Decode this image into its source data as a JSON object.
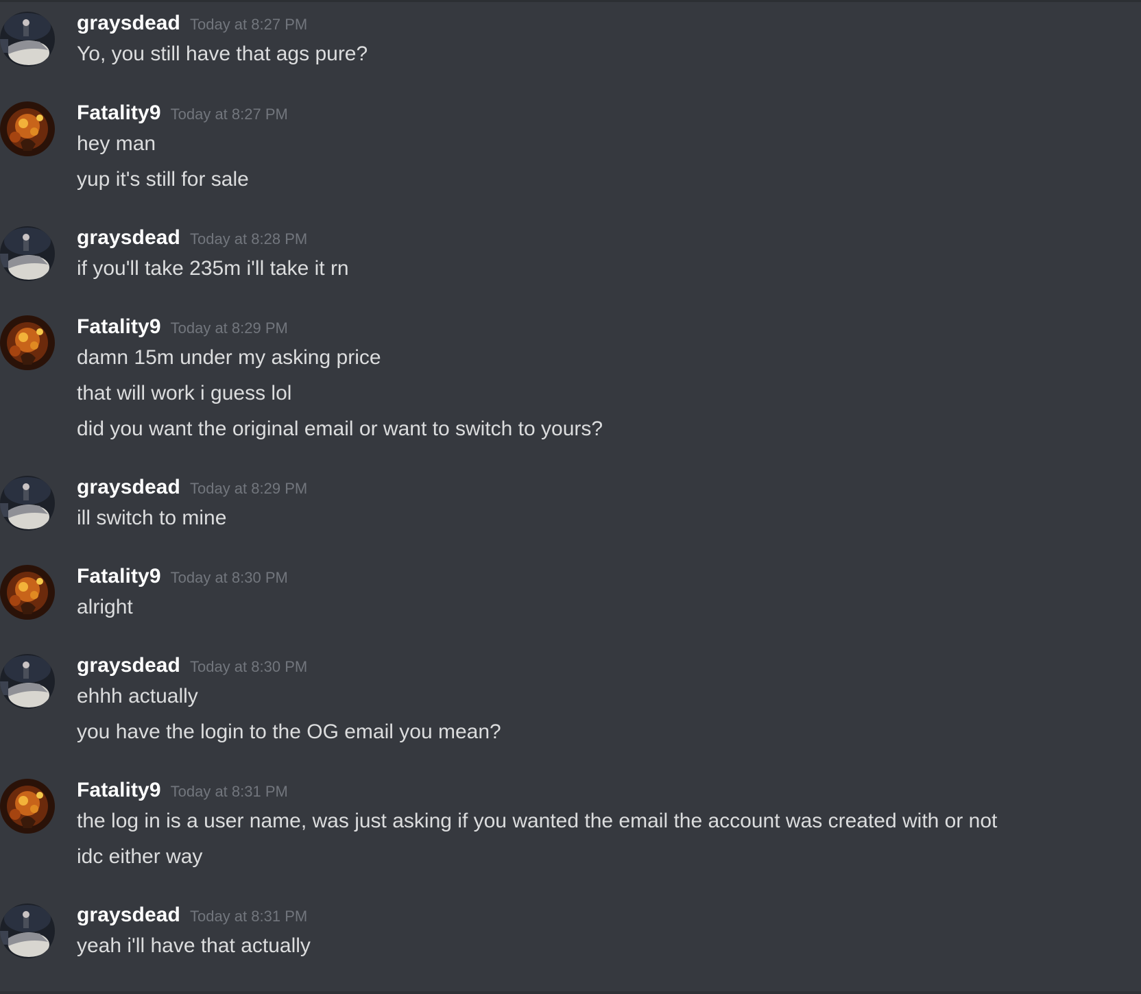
{
  "messages": [
    {
      "author": "graysdead",
      "avatar_icon": "graysdead-avatar-icon",
      "timestamp": "Today at 8:27 PM",
      "lines": [
        "Yo, you still have that ags pure?"
      ]
    },
    {
      "author": "Fatality9",
      "avatar_icon": "fatality9-avatar-icon",
      "timestamp": "Today at 8:27 PM",
      "lines": [
        "hey man",
        "yup it's still for sale"
      ]
    },
    {
      "author": "graysdead",
      "avatar_icon": "graysdead-avatar-icon",
      "timestamp": "Today at 8:28 PM",
      "lines": [
        "if you'll take 235m i'll take it rn"
      ]
    },
    {
      "author": "Fatality9",
      "avatar_icon": "fatality9-avatar-icon",
      "timestamp": "Today at 8:29 PM",
      "lines": [
        "damn 15m under my asking price",
        "that will work i guess lol",
        "did you want the original email or want to switch to yours?"
      ]
    },
    {
      "author": "graysdead",
      "avatar_icon": "graysdead-avatar-icon",
      "timestamp": "Today at 8:29 PM",
      "lines": [
        "ill switch to mine"
      ]
    },
    {
      "author": "Fatality9",
      "avatar_icon": "fatality9-avatar-icon",
      "timestamp": "Today at 8:30 PM",
      "lines": [
        "alright"
      ]
    },
    {
      "author": "graysdead",
      "avatar_icon": "graysdead-avatar-icon",
      "timestamp": "Today at 8:30 PM",
      "lines": [
        "ehhh actually",
        "you have the login to the OG email you mean?"
      ]
    },
    {
      "author": "Fatality9",
      "avatar_icon": "fatality9-avatar-icon",
      "timestamp": "Today at 8:31 PM",
      "lines": [
        "the log in is a user name, was just asking if you wanted the email the account was created with or not",
        "idc either way"
      ]
    },
    {
      "author": "graysdead",
      "avatar_icon": "graysdead-avatar-icon",
      "timestamp": "Today at 8:31 PM",
      "lines": [
        "yeah i'll have that actually"
      ]
    }
  ],
  "colors": {
    "background": "#36393f",
    "username": "#ffffff",
    "timestamp": "#72767d",
    "message_text": "#dcddde"
  }
}
